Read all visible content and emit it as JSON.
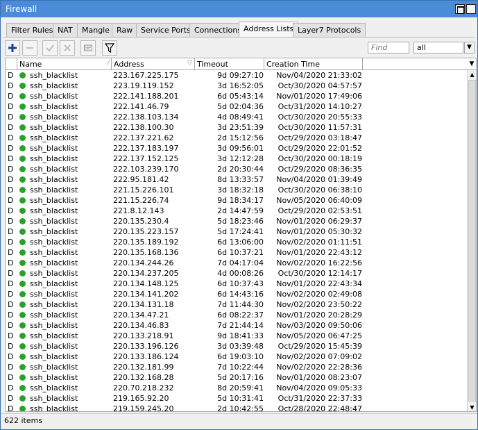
{
  "window": {
    "title": "Firewall"
  },
  "tabs": [
    {
      "label": "Filter Rules",
      "active": false
    },
    {
      "label": "NAT",
      "active": false
    },
    {
      "label": "Mangle",
      "active": false
    },
    {
      "label": "Raw",
      "active": false
    },
    {
      "label": "Service Ports",
      "active": false
    },
    {
      "label": "Connections",
      "active": false
    },
    {
      "label": "Address Lists",
      "active": true
    },
    {
      "label": "Layer7 Protocols",
      "active": false
    }
  ],
  "toolbar": {
    "icons": [
      "add-icon",
      "remove-icon",
      "enable-icon",
      "disable-icon",
      "comment-icon",
      "filter-icon"
    ],
    "find_placeholder": "Find",
    "filter_value": "all"
  },
  "table": {
    "columns": [
      "Name",
      "Address",
      "Timeout",
      "Creation Time"
    ],
    "rows": [
      {
        "flag": "D",
        "name": "ssh_blacklist",
        "address": "223.167.225.175",
        "timeout": "9d 09:27:10",
        "created": "Nov/04/2020 21:33:02"
      },
      {
        "flag": "D",
        "name": "ssh_blacklist",
        "address": "223.19.119.152",
        "timeout": "3d 16:52:05",
        "created": "Oct/30/2020 04:57:57"
      },
      {
        "flag": "D",
        "name": "ssh_blacklist",
        "address": "222.141.188.201",
        "timeout": "6d 05:43:14",
        "created": "Nov/01/2020 17:49:06"
      },
      {
        "flag": "D",
        "name": "ssh_blacklist",
        "address": "222.141.46.79",
        "timeout": "5d 02:04:36",
        "created": "Oct/31/2020 14:10:27"
      },
      {
        "flag": "D",
        "name": "ssh_blacklist",
        "address": "222.138.103.134",
        "timeout": "4d 08:49:41",
        "created": "Oct/30/2020 20:55:33"
      },
      {
        "flag": "D",
        "name": "ssh_blacklist",
        "address": "222.138.100.30",
        "timeout": "3d 23:51:39",
        "created": "Oct/30/2020 11:57:31"
      },
      {
        "flag": "D",
        "name": "ssh_blacklist",
        "address": "222.137.221.62",
        "timeout": "2d 15:12:56",
        "created": "Oct/29/2020 03:18:47"
      },
      {
        "flag": "D",
        "name": "ssh_blacklist",
        "address": "222.137.183.197",
        "timeout": "3d 09:56:01",
        "created": "Oct/29/2020 22:01:52"
      },
      {
        "flag": "D",
        "name": "ssh_blacklist",
        "address": "222.137.152.125",
        "timeout": "3d 12:12:28",
        "created": "Oct/30/2020 00:18:19"
      },
      {
        "flag": "D",
        "name": "ssh_blacklist",
        "address": "222.103.239.170",
        "timeout": "2d 20:30:44",
        "created": "Oct/29/2020 08:36:35"
      },
      {
        "flag": "D",
        "name": "ssh_blacklist",
        "address": "222.95.181.42",
        "timeout": "8d 13:33:57",
        "created": "Nov/04/2020 01:39:49"
      },
      {
        "flag": "D",
        "name": "ssh_blacklist",
        "address": "221.15.226.101",
        "timeout": "3d 18:32:18",
        "created": "Oct/30/2020 06:38:10"
      },
      {
        "flag": "D",
        "name": "ssh_blacklist",
        "address": "221.15.226.74",
        "timeout": "9d 18:34:17",
        "created": "Nov/05/2020 06:40:09"
      },
      {
        "flag": "D",
        "name": "ssh_blacklist",
        "address": "221.8.12.143",
        "timeout": "2d 14:47:59",
        "created": "Oct/29/2020 02:53:51"
      },
      {
        "flag": "D",
        "name": "ssh_blacklist",
        "address": "220.135.230.4",
        "timeout": "5d 18:23:46",
        "created": "Nov/01/2020 06:29:37"
      },
      {
        "flag": "D",
        "name": "ssh_blacklist",
        "address": "220.135.223.157",
        "timeout": "5d 17:24:41",
        "created": "Nov/01/2020 05:30:32"
      },
      {
        "flag": "D",
        "name": "ssh_blacklist",
        "address": "220.135.189.192",
        "timeout": "6d 13:06:00",
        "created": "Nov/02/2020 01:11:51"
      },
      {
        "flag": "D",
        "name": "ssh_blacklist",
        "address": "220.135.168.136",
        "timeout": "6d 10:37:21",
        "created": "Nov/01/2020 22:43:12"
      },
      {
        "flag": "D",
        "name": "ssh_blacklist",
        "address": "220.134.244.26",
        "timeout": "7d 04:17:04",
        "created": "Nov/02/2020 16:22:56"
      },
      {
        "flag": "D",
        "name": "ssh_blacklist",
        "address": "220.134.237.205",
        "timeout": "4d 00:08:26",
        "created": "Oct/30/2020 12:14:17"
      },
      {
        "flag": "D",
        "name": "ssh_blacklist",
        "address": "220.134.148.125",
        "timeout": "6d 10:37:43",
        "created": "Nov/01/2020 22:43:34"
      },
      {
        "flag": "D",
        "name": "ssh_blacklist",
        "address": "220.134.141.202",
        "timeout": "6d 14:43:16",
        "created": "Nov/02/2020 02:49:08"
      },
      {
        "flag": "D",
        "name": "ssh_blacklist",
        "address": "220.134.131.18",
        "timeout": "7d 11:44:30",
        "created": "Nov/02/2020 23:50:22"
      },
      {
        "flag": "D",
        "name": "ssh_blacklist",
        "address": "220.134.47.21",
        "timeout": "6d 08:22:37",
        "created": "Nov/01/2020 20:28:29"
      },
      {
        "flag": "D",
        "name": "ssh_blacklist",
        "address": "220.134.46.83",
        "timeout": "7d 21:44:14",
        "created": "Nov/03/2020 09:50:06"
      },
      {
        "flag": "D",
        "name": "ssh_blacklist",
        "address": "220.133.218.91",
        "timeout": "9d 18:41:33",
        "created": "Nov/05/2020 06:47:25"
      },
      {
        "flag": "D",
        "name": "ssh_blacklist",
        "address": "220.133.196.126",
        "timeout": "3d 03:39:48",
        "created": "Oct/29/2020 15:45:39"
      },
      {
        "flag": "D",
        "name": "ssh_blacklist",
        "address": "220.133.186.124",
        "timeout": "6d 19:03:10",
        "created": "Nov/02/2020 07:09:02"
      },
      {
        "flag": "D",
        "name": "ssh_blacklist",
        "address": "220.132.181.99",
        "timeout": "7d 10:22:44",
        "created": "Nov/02/2020 22:28:36"
      },
      {
        "flag": "D",
        "name": "ssh_blacklist",
        "address": "220.132.168.28",
        "timeout": "5d 20:17:16",
        "created": "Nov/01/2020 08:23:07"
      },
      {
        "flag": "D",
        "name": "ssh_blacklist",
        "address": "220.70.218.232",
        "timeout": "8d 20:59:41",
        "created": "Nov/04/2020 09:05:33"
      },
      {
        "flag": "D",
        "name": "ssh_blacklist",
        "address": "219.165.92.20",
        "timeout": "5d 10:31:41",
        "created": "Oct/31/2020 22:37:33"
      },
      {
        "flag": "D",
        "name": "ssh_blacklist",
        "address": "219.159.245.20",
        "timeout": "2d 10:42:55",
        "created": "Oct/28/2020 22:48:47"
      }
    ]
  },
  "status": {
    "count": "622 items"
  },
  "colors": {
    "titlebar": "#4a8cd8",
    "dynamic_dot": "#2aa02a",
    "add_icon": "#1a3f9c"
  }
}
